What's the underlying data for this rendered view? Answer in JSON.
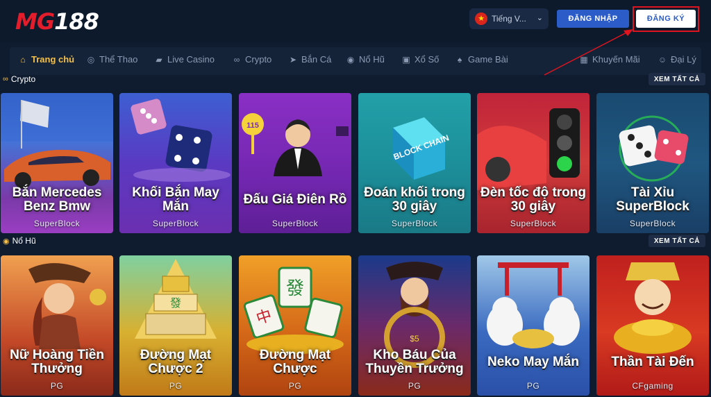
{
  "header": {
    "logo_mg": "MG",
    "logo_num": "188",
    "language": "Tiếng V...",
    "login_label": "ĐĂNG NHẬP",
    "register_label": "ĐĂNG KÝ"
  },
  "nav": {
    "items": [
      {
        "label": "Trang chủ",
        "icon": "home-icon"
      },
      {
        "label": "Thể Thao",
        "icon": "soccer-ball-icon"
      },
      {
        "label": "Live Casino",
        "icon": "video-camera-icon"
      },
      {
        "label": "Crypto",
        "icon": "link-icon"
      },
      {
        "label": "Bắn Cá",
        "icon": "fish-icon"
      },
      {
        "label": "Nổ Hũ",
        "icon": "slot-icon"
      },
      {
        "label": "Xổ Số",
        "icon": "ticket-icon"
      },
      {
        "label": "Game Bài",
        "icon": "cards-icon"
      },
      {
        "label": "Khuyến Mãi",
        "icon": "gift-icon"
      },
      {
        "label": "Đại Lý",
        "icon": "agent-icon"
      }
    ]
  },
  "sections": [
    {
      "title": "Crypto",
      "see_all": "XEM TẤT CẢ",
      "cards": [
        {
          "title": "Bắn Mercedes Benz Bmw",
          "provider": "SuperBlock"
        },
        {
          "title": "Khối Bắn May Mắn",
          "provider": "SuperBlock"
        },
        {
          "title": "Đấu Giá Điên Rồ",
          "provider": "SuperBlock"
        },
        {
          "title": "Đoán khối trong 30 giây",
          "provider": "SuperBlock"
        },
        {
          "title": "Đèn tốc độ trong 30 giây",
          "provider": "SuperBlock"
        },
        {
          "title": "Tài Xỉu SuperBlock",
          "provider": "SuperBlock"
        }
      ]
    },
    {
      "title": "Nổ Hũ",
      "see_all": "XEM TẤT CẢ",
      "cards": [
        {
          "title": "Nữ Hoàng Tiền Thưởng",
          "provider": "PG"
        },
        {
          "title": "Đường Mạt Chược 2",
          "provider": "PG"
        },
        {
          "title": "Đường Mạt Chược",
          "provider": "PG"
        },
        {
          "title": "Kho Báu Của Thuyền Trưởng",
          "provider": "PG"
        },
        {
          "title": "Neko May Mắn",
          "provider": "PG"
        },
        {
          "title": "Thần Tài Đến",
          "provider": "CFgaming"
        }
      ]
    }
  ],
  "art": {
    "auction_badge": "115",
    "blockchain_text": "BLOCK CHAIN",
    "mahjong_char": "發",
    "mahjong_char2": "中",
    "coin_text": "$5"
  },
  "colors": {
    "brand_red": "#e31d2b",
    "login_blue": "#2b5cc7",
    "active_nav": "#f5c04a",
    "highlight_box": "#e0141f"
  }
}
